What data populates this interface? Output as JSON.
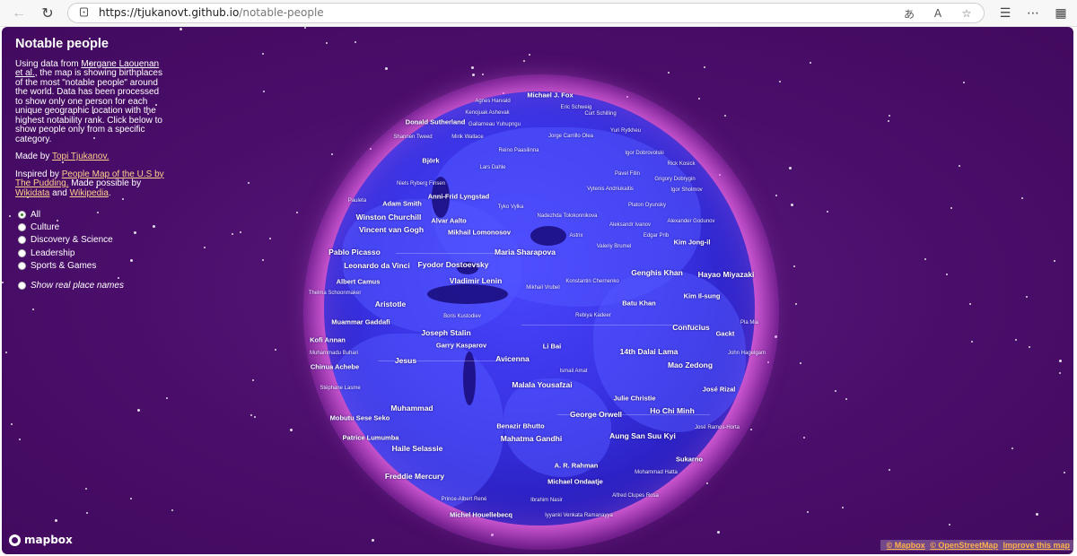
{
  "browser": {
    "url_host": "https://tjukanovt.github.io",
    "url_path": "/notable-people"
  },
  "panel": {
    "title": "Notable people",
    "intro_before": "Using data from ",
    "intro_link": "Morgane Laouenan et al.",
    "intro_after": ", the map is showing birthplaces of the most \"notable people\" around the world. Data has been processed to show only one person for each unique geographic location with the highest notability rank. Click below to show people only from a specific category.",
    "made_by_prefix": "Made by ",
    "made_by_link": "Topi Tjukanov.",
    "inspired_prefix": "Inspired by ",
    "inspired_link": "People Map of the U.S by The Pudding.",
    "possible_prefix": " Made possible by ",
    "wikidata_link": "Wikidata",
    "and_text": " and ",
    "wikipedia_link": "Wikipedia",
    "period": ".",
    "options": [
      "All",
      "Culture",
      "Discovery & Science",
      "Leadership",
      "Sports & Games"
    ],
    "selected_option": "All",
    "real_names_label": "Show real place names"
  },
  "map": {
    "logo_text": "mapbox",
    "attribution": [
      "© Mapbox",
      "© OpenStreetMap",
      "Improve this map"
    ],
    "labels": [
      {
        "name": "Michael J. Fox",
        "tier": 2
      },
      {
        "name": "Agnes Harvald",
        "tier": 3
      },
      {
        "name": "Kenojuak Ashevak",
        "tier": 3
      },
      {
        "name": "Eric Schweig",
        "tier": 3
      },
      {
        "name": "Donald Sutherland",
        "tier": 2
      },
      {
        "name": "Gallarneau Yuhupngu",
        "tier": 3
      },
      {
        "name": "Curt Schilling",
        "tier": 3
      },
      {
        "name": "Shannen Tweed",
        "tier": 3
      },
      {
        "name": "Mirik Wallace",
        "tier": 3
      },
      {
        "name": "Jorge Carrillo Olea",
        "tier": 3
      },
      {
        "name": "Yuri Rytkheu",
        "tier": 3
      },
      {
        "name": "Reino Paasilinna",
        "tier": 3
      },
      {
        "name": "Igor Dobrovolski",
        "tier": 3
      },
      {
        "name": "Björk",
        "tier": 2
      },
      {
        "name": "Lars Dahle",
        "tier": 3
      },
      {
        "name": "Rick Kosick",
        "tier": 3
      },
      {
        "name": "Pavel Fitin",
        "tier": 3
      },
      {
        "name": "Grigory Dobrygin",
        "tier": 3
      },
      {
        "name": "Niels Ryberg Finsen",
        "tier": 3
      },
      {
        "name": "Vytenis Andriukaitis",
        "tier": 3
      },
      {
        "name": "Igor Sholmov",
        "tier": 3
      },
      {
        "name": "Anni-Frid Lyngstad",
        "tier": 2
      },
      {
        "name": "Pauleta",
        "tier": 3
      },
      {
        "name": "Adam Smith",
        "tier": 2
      },
      {
        "name": "Tyko Vylka",
        "tier": 3
      },
      {
        "name": "Nadezhda Tolokonnikova",
        "tier": 3
      },
      {
        "name": "Platon Oyunsky",
        "tier": 3
      },
      {
        "name": "Winston Churchill",
        "tier": 1
      },
      {
        "name": "Alvar Aalto",
        "tier": 2
      },
      {
        "name": "Aleksandr Ivanov",
        "tier": 3
      },
      {
        "name": "Alexander Godunov",
        "tier": 3
      },
      {
        "name": "Vincent van Gogh",
        "tier": 1
      },
      {
        "name": "Mikhail Lomonosov",
        "tier": 2
      },
      {
        "name": "Astrix",
        "tier": 3
      },
      {
        "name": "Edgar Prib",
        "tier": 3
      },
      {
        "name": "Kim Jong-il",
        "tier": 2
      },
      {
        "name": "Valeriy Brumel",
        "tier": 3
      },
      {
        "name": "Pablo Picasso",
        "tier": 1
      },
      {
        "name": "Maria Sharapova",
        "tier": 1
      },
      {
        "name": "Leonardo da Vinci",
        "tier": 1
      },
      {
        "name": "Fyodor Dostoevsky",
        "tier": 1
      },
      {
        "name": "Genghis Khan",
        "tier": 1
      },
      {
        "name": "Hayao Miyazaki",
        "tier": 1
      },
      {
        "name": "Albert Camus",
        "tier": 2
      },
      {
        "name": "Vladimir Lenin",
        "tier": 1
      },
      {
        "name": "Konstantin Chernenko",
        "tier": 3
      },
      {
        "name": "Thelma Schoonmaker",
        "tier": 3
      },
      {
        "name": "Mikhail Vrubel",
        "tier": 3
      },
      {
        "name": "Kim Il-sung",
        "tier": 2
      },
      {
        "name": "Aristotle",
        "tier": 1
      },
      {
        "name": "Batu Khan",
        "tier": 2
      },
      {
        "name": "Boris Kustodiev",
        "tier": 3
      },
      {
        "name": "Rebiya Kadeer",
        "tier": 3
      },
      {
        "name": "Muammar Gaddafi",
        "tier": 2
      },
      {
        "name": "Pla Mia",
        "tier": 3
      },
      {
        "name": "Confucius",
        "tier": 1
      },
      {
        "name": "Joseph Stalin",
        "tier": 1
      },
      {
        "name": "Gackt",
        "tier": 2
      },
      {
        "name": "Kofi Annan",
        "tier": 2
      },
      {
        "name": "Garry Kasparov",
        "tier": 2
      },
      {
        "name": "Li Bai",
        "tier": 2
      },
      {
        "name": "Muhammadu Buhari",
        "tier": 3
      },
      {
        "name": "14th Dalai Lama",
        "tier": 1
      },
      {
        "name": "John Hagelgam",
        "tier": 3
      },
      {
        "name": "Jesus",
        "tier": 1
      },
      {
        "name": "Avicenna",
        "tier": 1
      },
      {
        "name": "Chinua Achebe",
        "tier": 2
      },
      {
        "name": "Mao Zedong",
        "tier": 1
      },
      {
        "name": "Ismail Amat",
        "tier": 3
      },
      {
        "name": "Malala Yousafzai",
        "tier": 1
      },
      {
        "name": "José Rizal",
        "tier": 2
      },
      {
        "name": "Stéphane Lasme",
        "tier": 3
      },
      {
        "name": "Julie Christie",
        "tier": 2
      },
      {
        "name": "Muhammad",
        "tier": 1
      },
      {
        "name": "Ho Chi Minh",
        "tier": 1
      },
      {
        "name": "George Orwell",
        "tier": 1
      },
      {
        "name": "Mobutu Sese Seko",
        "tier": 2
      },
      {
        "name": "José Ramos-Horta",
        "tier": 3
      },
      {
        "name": "Benazir Bhutto",
        "tier": 2
      },
      {
        "name": "Patrice Lumumba",
        "tier": 2
      },
      {
        "name": "Aung San Suu Kyi",
        "tier": 1
      },
      {
        "name": "Mahatma Gandhi",
        "tier": 1
      },
      {
        "name": "Haile Selassie",
        "tier": 1
      },
      {
        "name": "Sukarno",
        "tier": 2
      },
      {
        "name": "A. R. Rahman",
        "tier": 2
      },
      {
        "name": "Freddie Mercury",
        "tier": 1
      },
      {
        "name": "Mohammad Hatta",
        "tier": 3
      },
      {
        "name": "Michael Ondaatje",
        "tier": 2
      },
      {
        "name": "Alfred Clupes Rosa",
        "tier": 3
      },
      {
        "name": "Prince-Albert René",
        "tier": 3
      },
      {
        "name": "Ibrahim Nasir",
        "tier": 3
      },
      {
        "name": "Michel Houellebecq",
        "tier": 2
      },
      {
        "name": "Iyyanki Venkata Ramanayya",
        "tier": 3
      }
    ]
  }
}
